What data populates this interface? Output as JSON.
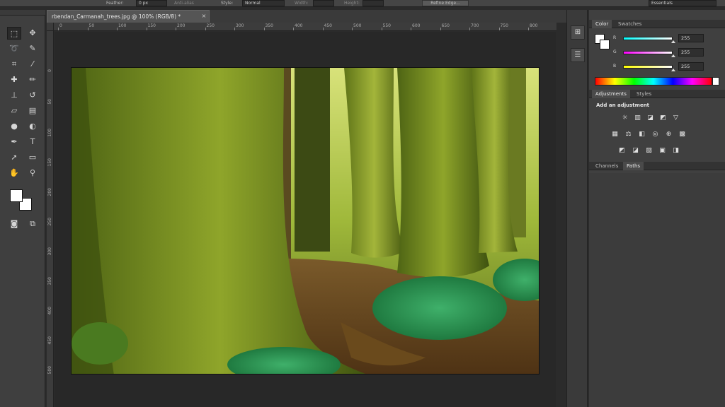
{
  "options_bar": {
    "feather_label": "Feather:",
    "feather_value": "0 px",
    "anti_alias_label": "Anti-alias",
    "style_label": "Style:",
    "style_value": "Normal",
    "width_label": "Width:",
    "height_label": "Height:",
    "refine_edge_label": "Refine Edge...",
    "workspace_value": "Essentials"
  },
  "document": {
    "tab_title": "rbendan_Carmanah_trees.jpg @ 100% (RGB/8) *",
    "close_glyph": "×"
  },
  "ruler": {
    "top_labels": [
      "0",
      "50",
      "100",
      "150",
      "200",
      "250",
      "300",
      "350",
      "400",
      "450",
      "500",
      "550",
      "600",
      "650",
      "700",
      "750",
      "800"
    ],
    "left_labels": [
      "0",
      "50",
      "100",
      "150",
      "200",
      "250",
      "300",
      "350",
      "400",
      "450",
      "500"
    ]
  },
  "tools": [
    {
      "name": "rectangular-marquee-tool",
      "glyph": "⬚"
    },
    {
      "name": "move-tool",
      "glyph": "✥"
    },
    {
      "name": "lasso-tool",
      "glyph": "➰"
    },
    {
      "name": "quick-selection-tool",
      "glyph": "✎"
    },
    {
      "name": "crop-tool",
      "glyph": "⌗"
    },
    {
      "name": "eyedropper-tool",
      "glyph": "⁄"
    },
    {
      "name": "spot-healing-brush-tool",
      "glyph": "✚"
    },
    {
      "name": "brush-tool",
      "glyph": "✏"
    },
    {
      "name": "clone-stamp-tool",
      "glyph": "⊥"
    },
    {
      "name": "history-brush-tool",
      "glyph": "↺"
    },
    {
      "name": "eraser-tool",
      "glyph": "▱"
    },
    {
      "name": "gradient-tool",
      "glyph": "▤"
    },
    {
      "name": "blur-tool",
      "glyph": "●"
    },
    {
      "name": "dodge-tool",
      "glyph": "◐"
    },
    {
      "name": "pen-tool",
      "glyph": "✒"
    },
    {
      "name": "type-tool",
      "glyph": "T"
    },
    {
      "name": "path-selection-tool",
      "glyph": "➚"
    },
    {
      "name": "rectangle-tool",
      "glyph": "▭"
    },
    {
      "name": "hand-tool",
      "glyph": "✋"
    },
    {
      "name": "zoom-tool",
      "glyph": "⚲"
    },
    {
      "name": "quick-mask-tool",
      "glyph": "◙"
    },
    {
      "name": "screen-mode-tool",
      "glyph": "⧉"
    }
  ],
  "colors": {
    "foreground": "#ffffff",
    "background": "#ffffff",
    "panel_accent": "#4a4a4a"
  },
  "color_panel": {
    "tabs": [
      "Color",
      "Swatches"
    ],
    "sliders": [
      {
        "label": "R",
        "value": "255",
        "from": "#000000",
        "to": "#ff0000"
      },
      {
        "label": "G",
        "value": "255",
        "from": "#ff00ff",
        "to": "#ffffff"
      },
      {
        "label": "B",
        "value": "255",
        "from": "#ffff00",
        "to": "#ffffff"
      }
    ]
  },
  "adjustments_panel": {
    "tabs": [
      "Adjustments",
      "Styles"
    ],
    "title": "Add an adjustment",
    "row1": [
      "☼",
      "▥",
      "◪",
      "◩",
      "▽"
    ],
    "row2": [
      "▦",
      "⚖",
      "◧",
      "◎",
      "⊕",
      "▩"
    ],
    "row3": [
      "◩",
      "◪",
      "▨",
      "▣",
      "◨"
    ]
  },
  "paths_panel": {
    "tabs": [
      "Channels",
      "Paths"
    ]
  }
}
